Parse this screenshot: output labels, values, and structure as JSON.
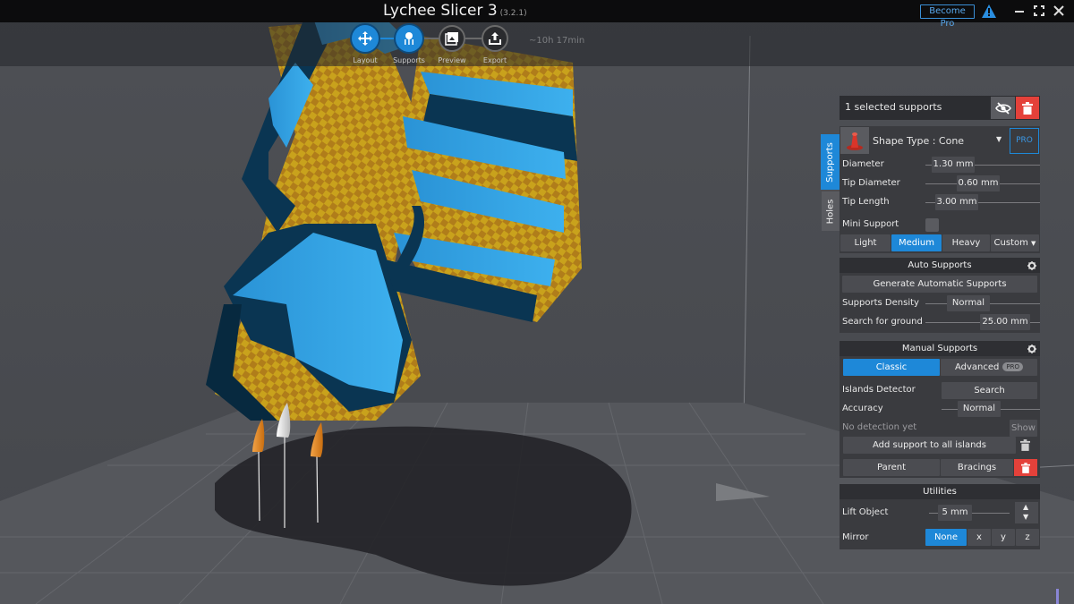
{
  "app": {
    "title": "Lychee Slicer 3",
    "version": "(3.2.1)",
    "become_pro": "Become Pro"
  },
  "steps": [
    {
      "label": "Layout",
      "active": true
    },
    {
      "label": "Supports",
      "active": true
    },
    {
      "label": "Preview",
      "active": false
    },
    {
      "label": "Export",
      "active": false
    }
  ],
  "print_time": "~10h 17min",
  "side_tabs": {
    "supports": "Supports",
    "holes": "Holes"
  },
  "selection": {
    "title": "1 selected supports"
  },
  "shape": {
    "label": "Shape Type : Cone",
    "pro": "PRO",
    "diameter_label": "Diameter",
    "diameter": "1.30 mm",
    "tip_diameter_label": "Tip Diameter",
    "tip_diameter": "0.60 mm",
    "tip_length_label": "Tip Length",
    "tip_length": "3.00 mm",
    "mini_support_label": "Mini Support",
    "presets": [
      "Light",
      "Medium",
      "Heavy",
      "Custom"
    ],
    "active_preset": "Medium"
  },
  "auto_supports": {
    "header": "Auto Supports",
    "generate": "Generate Automatic Supports",
    "density_label": "Supports Density",
    "density": "Normal",
    "ground_label": "Search for ground",
    "ground": "25.00 mm"
  },
  "manual_supports": {
    "header": "Manual Supports",
    "classic": "Classic",
    "advanced": "Advanced",
    "advanced_badge": "PRO",
    "islands_label": "Islands Detector",
    "search": "Search",
    "accuracy_label": "Accuracy",
    "accuracy": "Normal",
    "no_detection": "No detection yet",
    "show": "Show",
    "add_islands": "Add support to all islands",
    "parent": "Parent",
    "bracings": "Bracings"
  },
  "utilities": {
    "header": "Utilities",
    "lift_label": "Lift Object",
    "lift": "5 mm",
    "mirror_label": "Mirror",
    "mirror_options": [
      "None",
      "x",
      "y",
      "z"
    ]
  },
  "colors": {
    "accent": "#1e88d8",
    "danger": "#e4413a",
    "model_blue": "#2f9fe0",
    "support_orange": "#e98a1f"
  }
}
